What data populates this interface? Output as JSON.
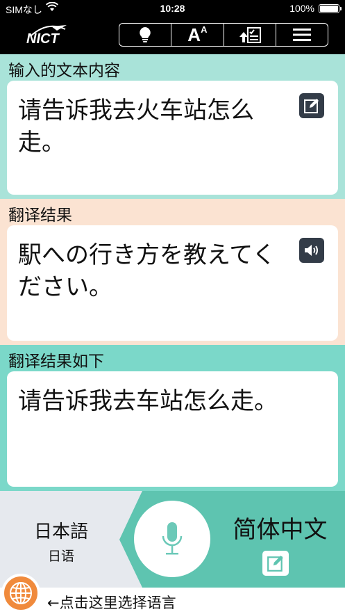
{
  "status_bar": {
    "carrier": "SIMなし",
    "time": "10:28",
    "battery": "100%"
  },
  "toolbar": {
    "logo_text": "NICT",
    "buttons": [
      {
        "icon": "lightbulb-icon"
      },
      {
        "icon": "font-size-icon",
        "label_big": "A",
        "label_small": "A"
      },
      {
        "icon": "upload-checklist-icon"
      },
      {
        "icon": "menu-icon"
      }
    ]
  },
  "input_section": {
    "label": "输入的文本内容",
    "text": "请告诉我去火车站怎么走。",
    "action_icon": "edit-icon"
  },
  "result_section": {
    "label": "翻译结果",
    "text": "駅への行き方を教えてください。",
    "action_icon": "speaker-icon"
  },
  "back_translation_section": {
    "label": "翻译结果如下",
    "text": "请告诉我去车站怎么走。"
  },
  "language_bar": {
    "left_language": "日本語",
    "left_language_sub": "日语",
    "right_language": "简体中文",
    "mic_icon": "microphone-icon",
    "edit_icon": "edit-icon"
  },
  "footer": {
    "hint": "←点击这里选择语言",
    "globe_icon": "globe-icon"
  },
  "colors": {
    "input_bg": "#a9e3d9",
    "result_bg": "#fbe3d2",
    "back_bg": "#7bd8c9",
    "language_green": "#5ec4b0",
    "language_gray": "#e6e9ee",
    "globe_orange": "#f08a3c",
    "icon_button_dark": "#333c48"
  }
}
